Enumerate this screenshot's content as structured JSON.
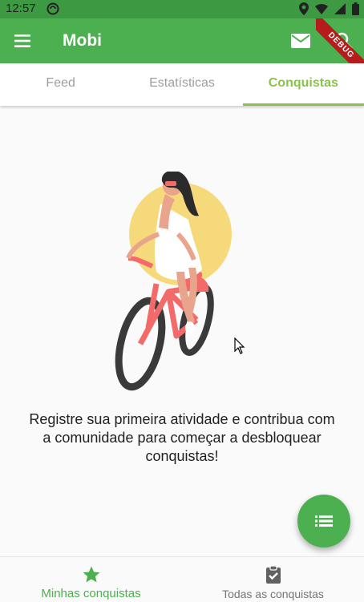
{
  "status_bar": {
    "time": "12:57"
  },
  "app_bar": {
    "title": "Mobi",
    "debug_label": "DEBUG"
  },
  "tabs": [
    {
      "label": "Feed"
    },
    {
      "label": "Estatísticas"
    },
    {
      "label": "Conquistas"
    }
  ],
  "content": {
    "message": "Registre sua primeira atividade e contribua com a comunidade para começar a desbloquear conquistas!"
  },
  "bottom_nav": [
    {
      "label": "Minhas conquistas",
      "icon": "star-icon"
    },
    {
      "label": "Todas as conquistas",
      "icon": "clipboard-check-icon"
    }
  ],
  "colors": {
    "primary": "#4caf50",
    "status_bar": "#3d9a43",
    "tab_active": "#8bc34a",
    "illustration_sun": "#f5d97a",
    "bike": "#f26a6a"
  }
}
